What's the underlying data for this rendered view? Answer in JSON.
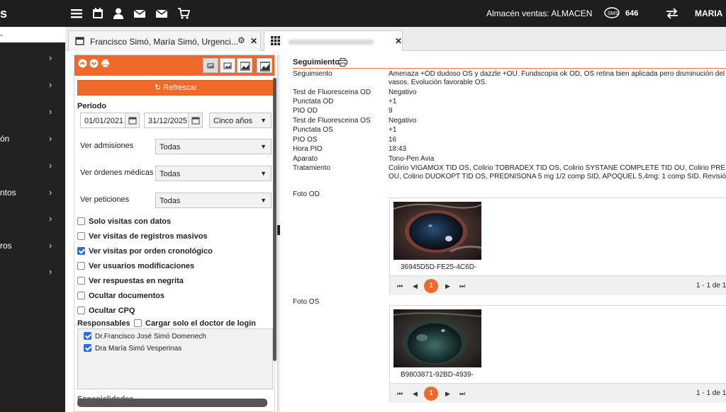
{
  "topbar": {
    "logo": "s",
    "store": "Almacén ventas: ALMACEN",
    "sms_count": "646",
    "user": "MARIA"
  },
  "sidebar": {
    "items": [
      {
        "label": ""
      },
      {
        "label": ""
      },
      {
        "label": ""
      },
      {
        "label": "ón"
      },
      {
        "label": ""
      },
      {
        "label": "ntos"
      },
      {
        "label": ""
      },
      {
        "label": "ros"
      },
      {
        "label": ""
      }
    ]
  },
  "tabs": [
    {
      "label": "Francisco Simó, María Simó, Urgenci..."
    },
    {
      "label": ""
    }
  ],
  "filters": {
    "refresh_label": "Refrescar",
    "periodo_label": "Período",
    "date_from": "01/01/2021",
    "date_to": "31/12/2025",
    "range_select": "Cinco años",
    "admisiones_label": "Ver admisiones",
    "admisiones_value": "Todas",
    "ordenes_label": "Ver órdenes médicas",
    "ordenes_value": "Todas",
    "peticiones_label": "Ver peticiones",
    "peticiones_value": "Todas",
    "checks": [
      {
        "label": "Solo visitas con datos",
        "checked": false
      },
      {
        "label": "Ver visitas de registros masivos",
        "checked": false
      },
      {
        "label": "Ver visitas por orden cronológico",
        "checked": true
      },
      {
        "label": "Ver usuarios modificaciones",
        "checked": false
      },
      {
        "label": "Ver respuestas en negrita",
        "checked": false
      },
      {
        "label": "Ocultar documentos",
        "checked": false
      },
      {
        "label": "Ocultar CPQ",
        "checked": false
      }
    ],
    "responsables_label": "Responsables",
    "cargar_label": "Cargar solo el doctor de login",
    "responsables": [
      {
        "label": "Dr.Francisco José Simó Domenech",
        "checked": true
      },
      {
        "label": "Dra María Simó Vesperinas",
        "checked": true
      }
    ],
    "especialidades_label": "Especialidades"
  },
  "seguimiento": {
    "title": "Seguimiento",
    "rows": [
      {
        "k": "Seguimiento",
        "v": "Amenaza +OD dudoso OS y dazzle +OU. Fundscopia ok OD, OS retina bien aplicada pero disminución del c"
      },
      {
        "k": "",
        "v": "vasos. Evolución favorable OS."
      },
      {
        "k": "Test de Fluoresceina OD",
        "v": "Negativo"
      },
      {
        "k": "Punctata OD",
        "v": "+1"
      },
      {
        "k": "PIO OD",
        "v": "9"
      },
      {
        "k": "Test de Fluoresceina OS",
        "v": "Negativo"
      },
      {
        "k": "Punctata OS",
        "v": "+1"
      },
      {
        "k": "PIO OS",
        "v": "16"
      },
      {
        "k": "Hora PIO",
        "v": "18:43"
      },
      {
        "k": "Aparato",
        "v": "Tono-Pen Avia"
      },
      {
        "k": "Tratamiento",
        "v": "Colirio VIGAMOX TID OS, Colirio TOBRADEX TID OS, Colirio SYSTANE COMPLETE TID OU, Colirio PRED FO"
      },
      {
        "k": "",
        "v": "OU,  Colirio DUOKOPT TID OS, PREDNISONA 5 mg 1/2 comp SID, APOQUEL 5,4mg: 1 comp SID. Revisión"
      }
    ],
    "foto_od_label": "Foto OD",
    "foto_od_caption": "36945D5D-FE25-4C6D-",
    "foto_os_label": "Foto OS",
    "foto_os_caption": "B9803871-92BD-4939-",
    "page": "1",
    "page_info": "1 - 1 de 1"
  }
}
